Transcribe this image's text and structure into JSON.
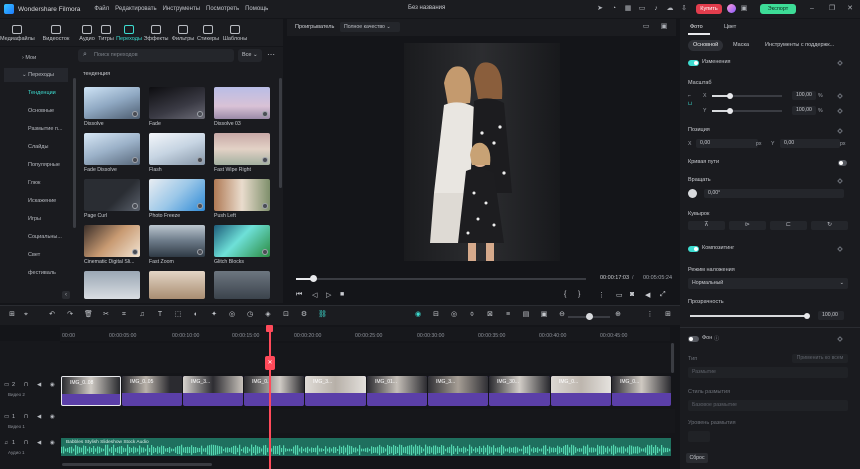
{
  "app": {
    "name": "Wondershare Filmora",
    "project_name": "Без названия"
  },
  "menu": [
    "Файл",
    "Редактировать",
    "Инструменты",
    "Посмотреть",
    "Помощь"
  ],
  "titlebar": {
    "buy_label": "Купить",
    "export_label": "Экспорт"
  },
  "left_tabs": [
    "Медиафайлы",
    "Видеосток",
    "Аудио",
    "Титры",
    "Переходы",
    "Эффекты",
    "Фильтры",
    "Стикеры",
    "Шаблоны"
  ],
  "left_active_tab": "Переходы",
  "categories": {
    "mine": "Мои",
    "transitions": "Переходы",
    "items": [
      "Тенденции",
      "Основные",
      "Размытие п...",
      "Слайды",
      "Популярные",
      "Глюк",
      "Искажение",
      "Игры",
      "Социальны...",
      "Свет",
      "фестиваль"
    ]
  },
  "search": {
    "placeholder": "Поиск переходов",
    "filter": "Все"
  },
  "section_title": "тенденция",
  "thumbnails": [
    {
      "label": "Dissolve"
    },
    {
      "label": "Fade"
    },
    {
      "label": "Dissolve 03"
    },
    {
      "label": "Fade Dissolve"
    },
    {
      "label": "Flash"
    },
    {
      "label": "Fast Wipe Right"
    },
    {
      "label": "Page Curl"
    },
    {
      "label": "Photo Freeze"
    },
    {
      "label": "Push Left"
    },
    {
      "label": "Cinematic Digital Sli..."
    },
    {
      "label": "Fast Zoom"
    },
    {
      "label": "Glitch Blocks"
    },
    {
      "label": ""
    },
    {
      "label": ""
    },
    {
      "label": ""
    }
  ],
  "preview": {
    "player_label": "Проигрыватель",
    "quality": "Полное качество",
    "current_time": "00:00:17:03",
    "separator": "/",
    "total_time": "00:05:05:24",
    "progress": 0.06
  },
  "right_panel": {
    "tabs": [
      "Фото",
      "Цвет"
    ],
    "subtabs": [
      "Основной",
      "Маска",
      "Инструменты с поддержк..."
    ],
    "changes_label": "Изменения",
    "scale_label": "Масштаб",
    "scale_x_label": "X",
    "scale_y_label": "Y",
    "scale_x": "100,00",
    "scale_y": "100,00",
    "percent": "%",
    "position_label": "Позиция",
    "pos_x_label": "X",
    "pos_y_label": "Y",
    "pos_x": "0,00",
    "pos_y": "0,00",
    "px_unit": "px",
    "curve_label": "Кривая пути",
    "rotate_label": "Вращать",
    "rotate_value": "0,00°",
    "flip_label": "Кувырок",
    "compositing_label": "Композитинг",
    "blend_label": "Режим наложения",
    "blend_value": "Нормальный",
    "opacity_label": "Прозрачность",
    "opacity_value": "100,00",
    "opacity": 1.0,
    "background_label": "Фон",
    "type_label": "Тип",
    "apply_all": "Применить ко всем",
    "blur_value": "Размытие",
    "blur_style_label": "Стиль размытия",
    "blur_style_value": "Базовое размытие",
    "blur_level_label": "Уровень размытия",
    "reset_label": "Сброс"
  },
  "timeline": {
    "ticks": [
      "00:00",
      "00:00:05:00",
      "00:00:10:00",
      "00:00:15:00",
      "00:00:20:00",
      "00:00:25:00",
      "00:00:30:00",
      "00:00:35:00",
      "00:00:40:00",
      "00:00:45:00"
    ],
    "tracks": [
      {
        "name": "Видео 2",
        "index": "2"
      },
      {
        "name": "Видео 1",
        "index": "1"
      },
      {
        "name": "Аудио 1",
        "index": "1"
      }
    ],
    "clips": [
      {
        "label": "IMG_0..08"
      },
      {
        "label": "IMG_0..05"
      },
      {
        "label": "IMG_3..."
      },
      {
        "label": "IMG_0..."
      },
      {
        "label": "IMG_3..."
      },
      {
        "label": "IMG_01..."
      },
      {
        "label": "IMG_3..."
      },
      {
        "label": "IMG_30..."
      },
      {
        "label": "IMG_0..."
      },
      {
        "label": "IMG_0..."
      }
    ],
    "audio_label": "Babbles Stylish   Slideshow   Stock Audio"
  },
  "colors": {
    "accent": "#3ddcd0",
    "buy": "#e23d4d",
    "export": "#3ddc97",
    "playhead": "#ff4a5a",
    "clip": "#5b3fa8",
    "audio": "#1f6f5e"
  }
}
